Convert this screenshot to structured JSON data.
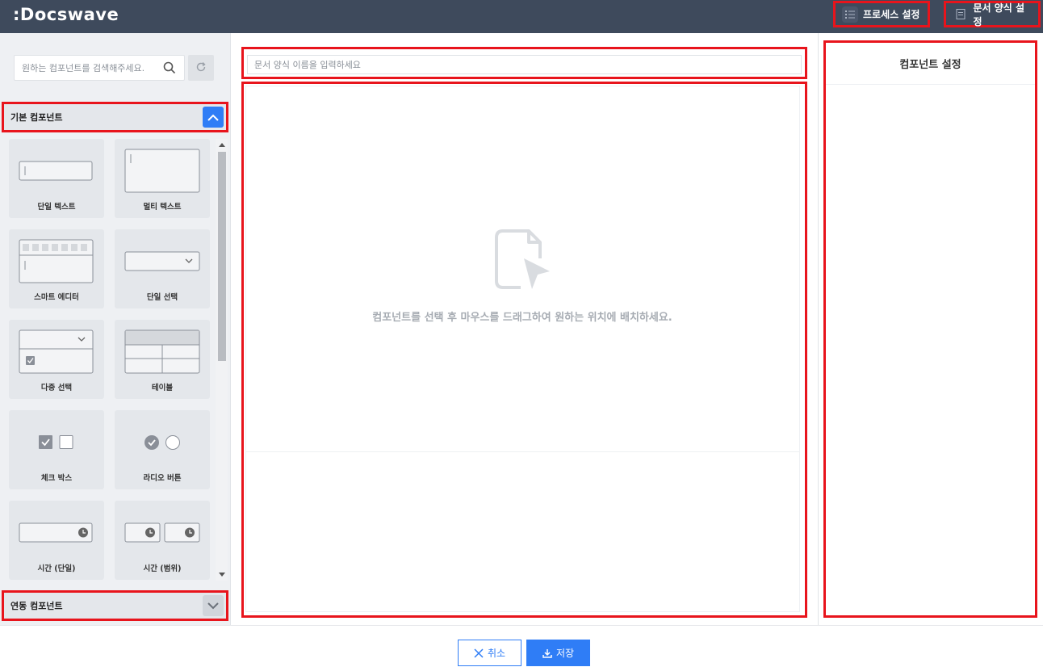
{
  "app": {
    "logo": ":Docswave"
  },
  "topbar": {
    "process_settings": "프로세스 설정",
    "form_settings": "문서 양식 설정"
  },
  "sidebar": {
    "search_placeholder": "원하는 컴포넌트를 검색해주세요.",
    "basic_section": "기본 컴포넌트",
    "linked_section": "연동 컴포넌트",
    "components": [
      {
        "label": "단일 텍스트",
        "icon": "single-text-icon"
      },
      {
        "label": "멀티 텍스트",
        "icon": "multi-text-icon"
      },
      {
        "label": "스마트 에디터",
        "icon": "smart-editor-icon"
      },
      {
        "label": "단일 선택",
        "icon": "single-select-icon"
      },
      {
        "label": "다중 선택",
        "icon": "multi-select-icon"
      },
      {
        "label": "테이블",
        "icon": "table-icon"
      },
      {
        "label": "체크 박스",
        "icon": "checkbox-icon"
      },
      {
        "label": "라디오 버튼",
        "icon": "radio-icon"
      },
      {
        "label": "시간 (단일)",
        "icon": "time-single-icon"
      },
      {
        "label": "시간 (범위)",
        "icon": "time-range-icon"
      }
    ]
  },
  "editor": {
    "doc_name_placeholder": "문서 양식 이름을 입력하세요",
    "drop_message": "컴포넌트를 선택 후 마우스를 드래그하여 원하는 위치에 배치하세요."
  },
  "settings_panel": {
    "title": "컴포넌트 설정"
  },
  "footer": {
    "cancel": "취소",
    "save": "저장"
  },
  "colors": {
    "topbar": "#3e4a5c",
    "accent": "#2f7df6",
    "highlight": "#e8141c"
  }
}
